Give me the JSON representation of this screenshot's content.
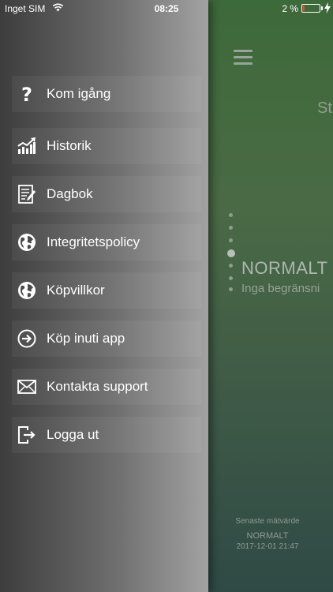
{
  "status_bar": {
    "carrier": "Inget SIM",
    "time": "08:25",
    "battery_percent": "2 %",
    "battery_level": 0.02,
    "battery_color": "#ff3b30"
  },
  "menu": {
    "items": [
      {
        "label": "Kom igång",
        "icon": "question-icon"
      },
      {
        "label": "Historik",
        "icon": "chart-icon"
      },
      {
        "label": "Dagbok",
        "icon": "diary-icon"
      },
      {
        "label": "Integritetspolicy",
        "icon": "globe-icon"
      },
      {
        "label": "Köpvillkor",
        "icon": "globe-icon"
      },
      {
        "label": "Köp inuti app",
        "icon": "arrow-circle-icon"
      },
      {
        "label": "Kontakta support",
        "icon": "mail-icon"
      },
      {
        "label": "Logga ut",
        "icon": "logout-icon"
      }
    ]
  },
  "main": {
    "title_partial": "St",
    "status": "NORMALT",
    "status_sub": "Inga begränsni",
    "last_label": "Senaste mätvärde",
    "last_value": "NORMALT",
    "last_time": "2017-12-01 21:47"
  }
}
